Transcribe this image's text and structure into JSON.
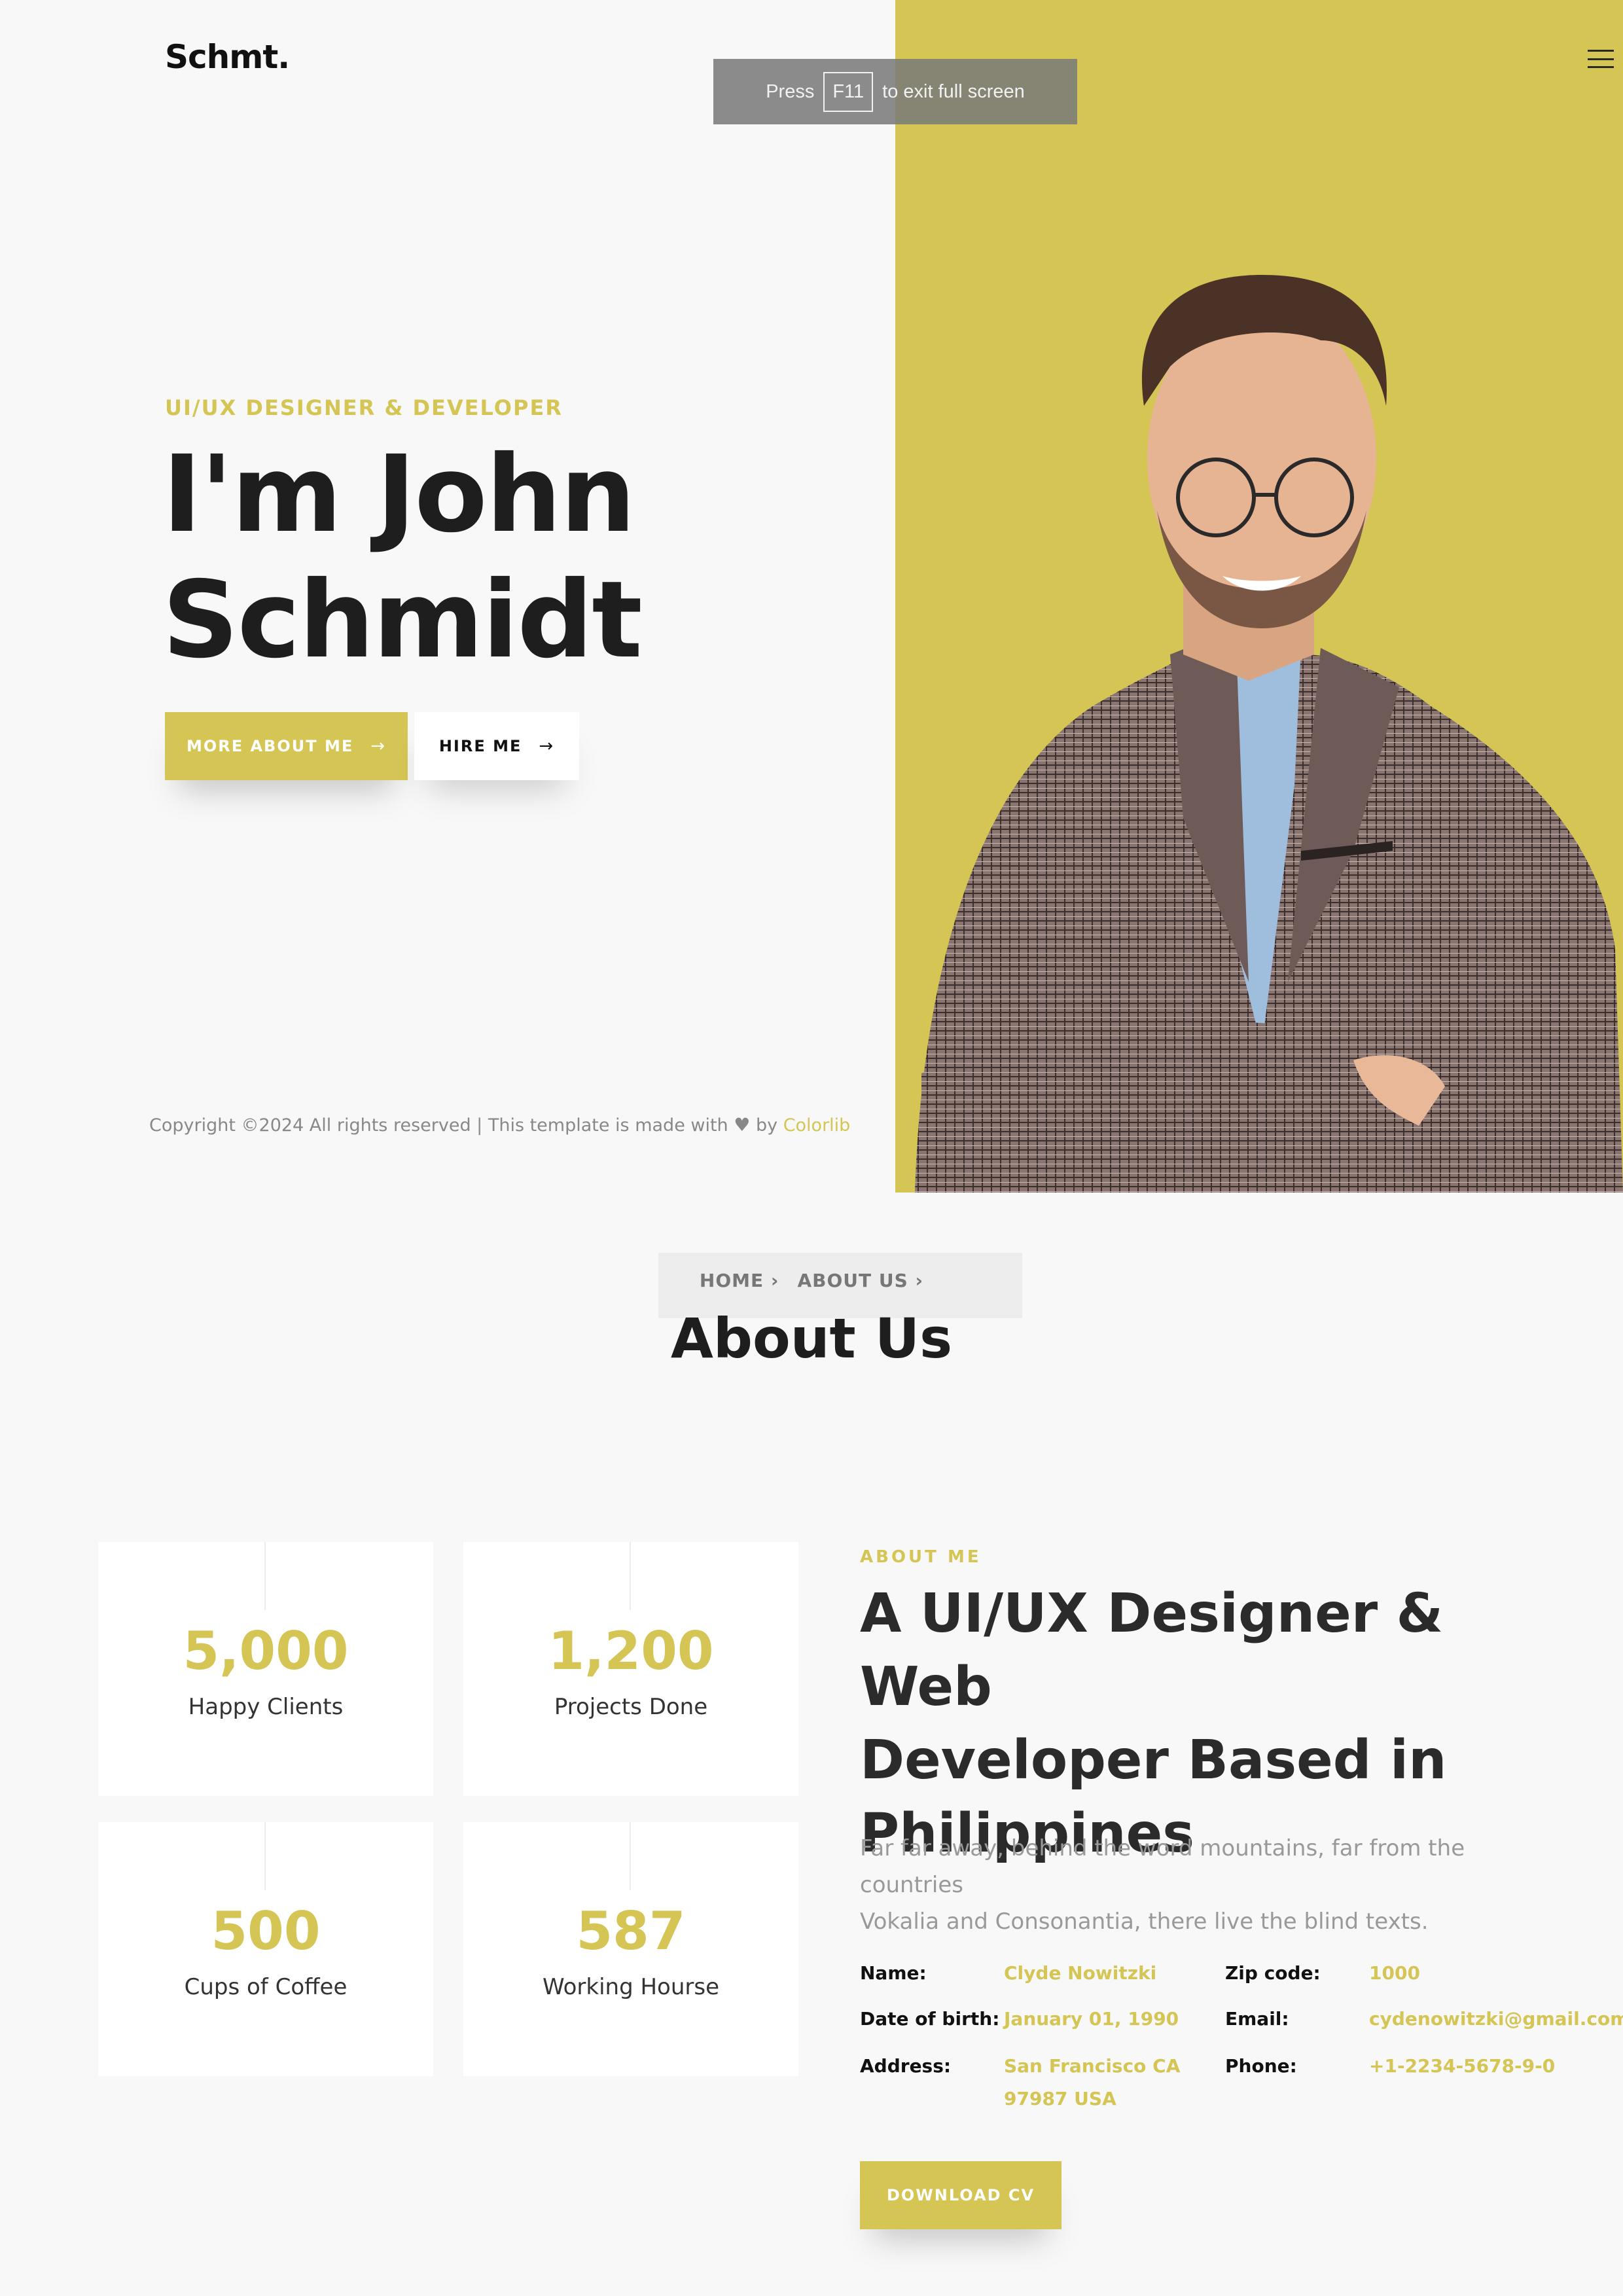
{
  "brand": {
    "logo": "Schmt.",
    "accent_color": "#d4c554"
  },
  "fullscreen_toast": {
    "prefix": "Press",
    "key": "F11",
    "suffix": "to exit full screen"
  },
  "hero": {
    "subtitle": "UI/UX DESIGNER & DEVELOPER",
    "name_line1": "I'm John",
    "name_line2": "Schmidt",
    "btn_more": "MORE ABOUT ME",
    "btn_hire": "HIRE ME",
    "arrow_icon": "→"
  },
  "copyright": {
    "text": "Copyright ©2024 All rights reserved | This template is made with",
    "by": "by",
    "link": "Colorlib"
  },
  "breadcrumb": {
    "home": "HOME",
    "about": "ABOUT US",
    "sep": "›"
  },
  "about_title": "About Us",
  "stats": [
    {
      "value": "5,000",
      "label": "Happy Clients"
    },
    {
      "value": "1,200",
      "label": "Projects Done"
    },
    {
      "value": "500",
      "label": "Cups of Coffee"
    },
    {
      "value": "587",
      "label": "Working Hourse"
    }
  ],
  "about": {
    "label": "ABOUT ME",
    "heading_line1": "A UI/UX Designer & Web",
    "heading_line2": "Developer Based in",
    "heading_line3": "Philippines",
    "desc_line1": "Far far away, behind the word mountains, far from the countries",
    "desc_line2": "Vokalia and Consonantia, there live the blind texts.",
    "info": {
      "name_k": "Name:",
      "name_v": "Clyde Nowitzki",
      "dob_k": "Date of birth:",
      "dob_v": "January 01, 1990",
      "address_k": "Address:",
      "address_v1": "San Francisco CA",
      "address_v2": "97987 USA",
      "zip_k": "Zip code:",
      "zip_v": "1000",
      "email_k": "Email:",
      "email_v": "cydenowitzki@gmail.com",
      "phone_k": "Phone:",
      "phone_v": "+1-2234-5678-9-0"
    },
    "btn_cv": "DOWNLOAD CV"
  }
}
